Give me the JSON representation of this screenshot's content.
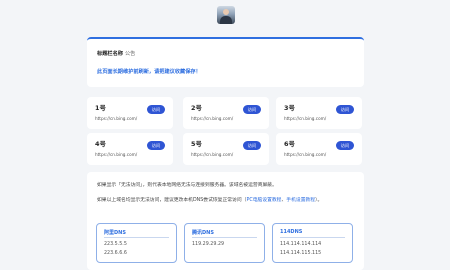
{
  "notice": {
    "title": "标题栏名称",
    "tag": "公告",
    "message": "此页面长期维护前刷新，请把建议收藏保存！"
  },
  "sites": [
    {
      "name": "1号",
      "url": "https://cn.bing.com/",
      "button": "访问"
    },
    {
      "name": "2号",
      "url": "https://cn.bing.com/",
      "button": "访问"
    },
    {
      "name": "3号",
      "url": "https://cn.bing.com/",
      "button": "访问"
    },
    {
      "name": "4号",
      "url": "https://cn.bing.com/",
      "button": "访问"
    },
    {
      "name": "5号",
      "url": "https://cn.bing.com/",
      "button": "访问"
    },
    {
      "name": "6号",
      "url": "https://cn.bing.com/",
      "button": "访问"
    }
  ],
  "help": {
    "line1": "如果显示「无法访问」，则代表本地网络无法与连接到服务器。该域名被运营商屏蔽。",
    "line2_prefix": "如果以上域名均显示无法访问，建议更改本机DNS尝试恢复正常访问（",
    "link_pc": "PC电脑设置教程",
    "sep": "、",
    "link_mobile": "手机设置教程",
    "line2_suffix": "）。"
  },
  "dns": [
    {
      "name": "阿里DNS",
      "ip1": "223.5.5.5",
      "ip2": "223.6.6.6"
    },
    {
      "name": "腾讯DNS",
      "ip1": "119.29.29.29",
      "ip2": ""
    },
    {
      "name": "114DNS",
      "ip1": "114.114.114.114",
      "ip2": "114.114.115.115"
    }
  ]
}
